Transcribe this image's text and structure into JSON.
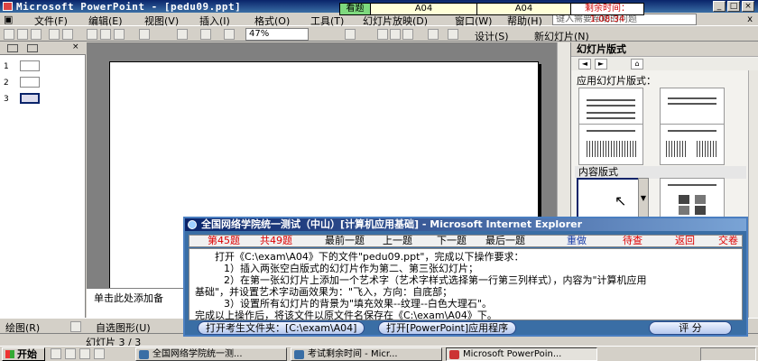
{
  "window": {
    "title": "Microsoft PowerPoint - [pedu09.ppt]"
  },
  "exam_timer": {
    "tab": "看题",
    "cell1": "A04",
    "cell2": "A04",
    "remaining": "剩余时间：1:08:34"
  },
  "menu": {
    "items": [
      "文件(F)",
      "编辑(E)",
      "视图(V)",
      "插入(I)",
      "格式(O)",
      "工具(T)",
      "幻灯片放映(D)",
      "窗口(W)",
      "帮助(H)"
    ],
    "help_placeholder": "键入需要帮助的问题",
    "close": "x"
  },
  "toolbar": {
    "zoom": "47%",
    "design_label": "设计(S)",
    "new_slide_label": "新幻灯片(N)"
  },
  "thumbnails": {
    "numbers": [
      "1",
      "2",
      "3"
    ],
    "selected_index": 3
  },
  "notes": {
    "placeholder": "单击此处添加备"
  },
  "task_pane": {
    "title": "幻灯片版式",
    "section_applied": "应用幻灯片版式：",
    "section_content": "内容版式"
  },
  "drawing_toolbar": {
    "draw": "绘图(R)",
    "autoshapes": "自选图形(U)"
  },
  "status_bar": {
    "slide_info": "幻灯片 3 / 3"
  },
  "exam_window": {
    "title": "全国网络学院统一测试（中山）[计算机应用基础] - Microsoft Internet Explorer",
    "current_q": "第45题",
    "total_q": "共49题",
    "nav": {
      "first": "最前一题",
      "prev": "上一题",
      "next": "下一题",
      "last": "最后一题",
      "redo": "重做",
      "review": "待查",
      "back": "返回",
      "submit": "交卷"
    },
    "lines": [
      "打开《C:\\exam\\A04》下的文件\"pedu09.ppt\"，完成以下操作要求：",
      "1）插入两张空白版式的幻灯片作为第二、第三张幻灯片；",
      "2）在第一张幻灯片上添加一个艺术字（艺术字样式选择第一行第三列样式），内容为\"计算机应用",
      "基础\"，并设置艺术字动画效果为：\"飞入，方向：自底部；",
      "3）设置所有幻灯片的背景为\"填充效果--纹理--白色大理石\"。",
      "完成以上操作后，将该文件以原文件名保存在《C:\\exam\\A04》下。"
    ],
    "btn_open_folder": "打开考生文件夹：[C:\\exam\\A04]",
    "btn_open_ppt": "打开[PowerPoint]应用程序",
    "btn_grade": "评 分"
  },
  "taskbar": {
    "start": "开始",
    "tasks": [
      "全国网络学院统一测...",
      "考试剩余时间 - Micr...",
      "Microsoft PowerPoin..."
    ]
  }
}
